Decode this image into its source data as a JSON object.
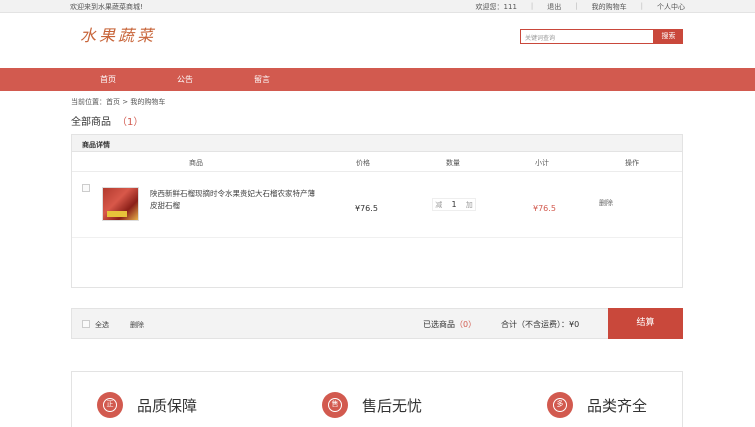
{
  "topbar": {
    "welcome": "欢迎来到水果蔬菜商城!",
    "user": "欢迎您：111",
    "logout": "退出",
    "my_cart": "我的购物车",
    "profile": "个人中心"
  },
  "header": {
    "logo": "水果蔬菜",
    "search_placeholder": "关键词查询",
    "search_button": "搜索"
  },
  "nav": {
    "items": [
      "首页",
      "公告",
      "留言"
    ]
  },
  "breadcrumb": "当前位置：首页 > 我的购物车",
  "cart": {
    "title": "全部商品",
    "count": "（1）",
    "panel_header": "商品详情",
    "columns": [
      "商品",
      "价格",
      "数量",
      "小计",
      "操作"
    ],
    "items": [
      {
        "name": "陕西新鲜石榴现摘时令水果贵妃大石榴农家特产薄皮甜石榴",
        "price": "¥76.5",
        "qty_minus": "减",
        "qty": "1",
        "qty_plus": "加",
        "subtotal": "¥76.5",
        "delete": "删除"
      }
    ],
    "footer": {
      "select_all": "全选",
      "delete": "删除",
      "chosen_label": "已选商品",
      "chosen_count": "（0）",
      "total_label": "合计（不含运费）：¥0",
      "checkout": "结算"
    }
  },
  "promises": [
    {
      "icon": "正",
      "label": "品质保障"
    },
    {
      "icon": "售",
      "label": "售后无忧"
    },
    {
      "icon": "多",
      "label": "品类齐全"
    }
  ],
  "colors": {
    "accent": "#d25a4f",
    "button": "#c9483b",
    "logo": "#c8653a"
  }
}
